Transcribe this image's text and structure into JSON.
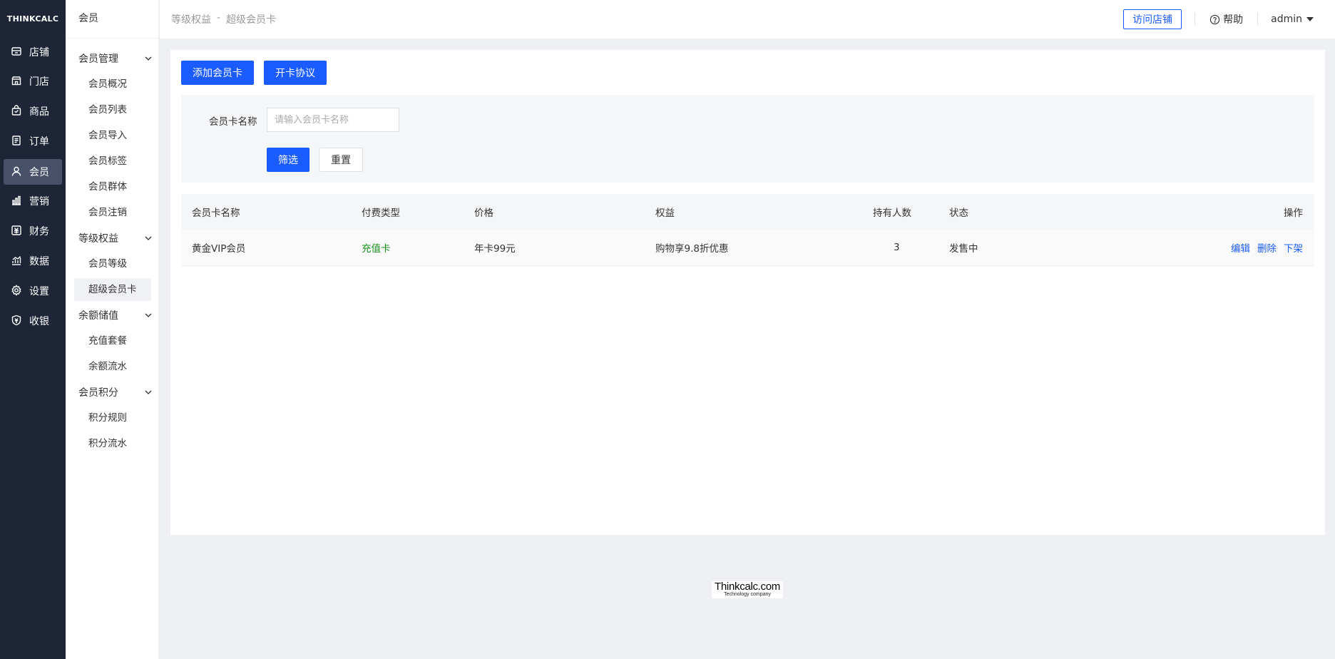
{
  "brand": "THINKCALC",
  "nav": [
    {
      "label": "店铺",
      "icon": "shop-icon"
    },
    {
      "label": "门店",
      "icon": "store-icon"
    },
    {
      "label": "商品",
      "icon": "goods-icon"
    },
    {
      "label": "订单",
      "icon": "order-icon"
    },
    {
      "label": "会员",
      "icon": "user-icon",
      "active": true
    },
    {
      "label": "营销",
      "icon": "bar-chart-icon"
    },
    {
      "label": "财务",
      "icon": "finance-icon"
    },
    {
      "label": "数据",
      "icon": "data-icon"
    },
    {
      "label": "设置",
      "icon": "gear-icon"
    },
    {
      "label": "收银",
      "icon": "cashier-icon"
    }
  ],
  "submenu": {
    "title": "会员",
    "groups": [
      {
        "label": "会员管理",
        "items": [
          "会员概况",
          "会员列表",
          "会员导入",
          "会员标签",
          "会员群体",
          "会员注销"
        ]
      },
      {
        "label": "等级权益",
        "items": [
          "会员等级",
          "超级会员卡"
        ]
      },
      {
        "label": "余额储值",
        "items": [
          "充值套餐",
          "余额流水"
        ]
      },
      {
        "label": "会员积分",
        "items": [
          "积分规则",
          "积分流水"
        ]
      }
    ],
    "active_item": "超级会员卡"
  },
  "header": {
    "breadcrumb": [
      "等级权益",
      "-",
      "超级会员卡"
    ],
    "visit_store": "访问店铺",
    "help": "帮助",
    "user": "admin"
  },
  "toolbar": {
    "add_card": "添加会员卡",
    "agreement": "开卡协议"
  },
  "filter": {
    "label": "会员卡名称",
    "placeholder": "请输入会员卡名称",
    "value": "",
    "search": "筛选",
    "reset": "重置"
  },
  "table": {
    "columns": [
      "会员卡名称",
      "付费类型",
      "价格",
      "权益",
      "持有人数",
      "状态",
      "操作"
    ],
    "rows": [
      {
        "name": "黄金VIP会员",
        "pay_type": "充值卡",
        "price": "年卡99元",
        "benefit": "购物享9.8折优惠",
        "holders": "3",
        "status": "发售中",
        "actions": [
          "编辑",
          "删除",
          "下架"
        ]
      }
    ]
  },
  "footer": {
    "logo_main": "Thinkcalc.com",
    "logo_sub": "Technology company"
  },
  "colors": {
    "sidebar_bg": "#1e2536",
    "primary": "#1a5cff",
    "page_bg": "#eef0f4",
    "pay_type_green": "#1a8f1a"
  }
}
